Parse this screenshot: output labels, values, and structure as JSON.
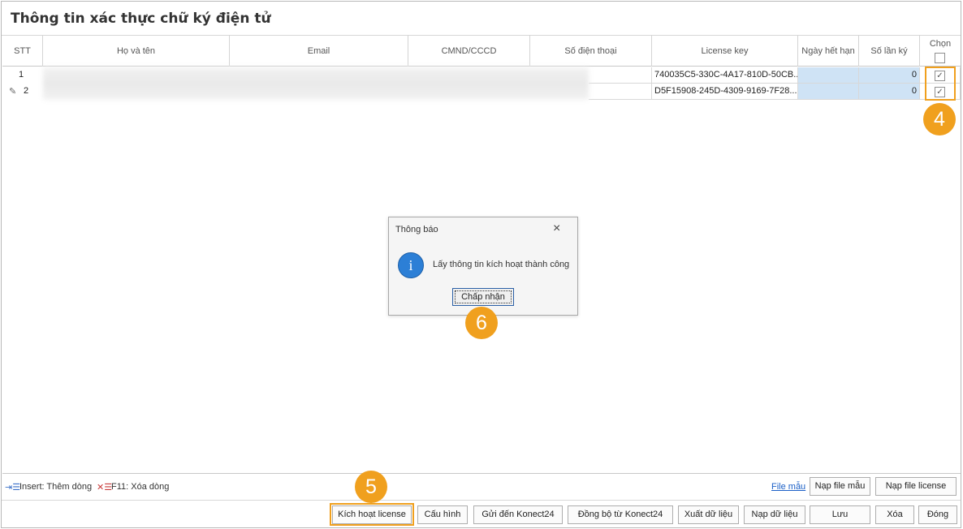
{
  "title": "Thông tin xác thực chữ ký điện tử",
  "columns": [
    "STT",
    "Họ và tên",
    "Email",
    "CMND/CCCD",
    "Số điện thoại",
    "License key",
    "Ngày hết hạn",
    "Số lần ký",
    "Chọn"
  ],
  "rows": [
    {
      "stt": "1",
      "license_key": "740035C5-330C-4A17-810D-50CB...",
      "so_lan_ky": "0",
      "chon": true
    },
    {
      "stt": "2",
      "license_key": "D5F15908-245D-4309-9169-7F28...",
      "so_lan_ky": "0",
      "chon": true
    }
  ],
  "dialog": {
    "title": "Thông báo",
    "close_icon": "×",
    "info_icon": "i",
    "message": "Lấy thông tin kích hoạt thành công",
    "ok_label": "Chấp nhận"
  },
  "callouts": {
    "c4": "4",
    "c5": "5",
    "c6": "6"
  },
  "status": {
    "insert_hint": "Insert: Thêm dòng",
    "delete_hint": "F11: Xóa dòng",
    "template_link": "File mẫu"
  },
  "buttons": {
    "import_template": "Nạp file mẫu",
    "import_license": "Nạp file license",
    "activate_license": "Kích hoạt license",
    "config": "Cấu hình",
    "send_konect": "Gửi đến Konect24",
    "sync_konect": "Đồng bộ từ Konect24",
    "export_data": "Xuất dữ liệu",
    "import_data": "Nạp dữ liệu",
    "save": "Lưu",
    "delete": "Xóa",
    "close": "Đóng"
  },
  "colors": {
    "accent": "#f0a01e",
    "selected_cell": "#cfe3f5",
    "link": "#1a5fc7",
    "info": "#2c7fd6"
  }
}
